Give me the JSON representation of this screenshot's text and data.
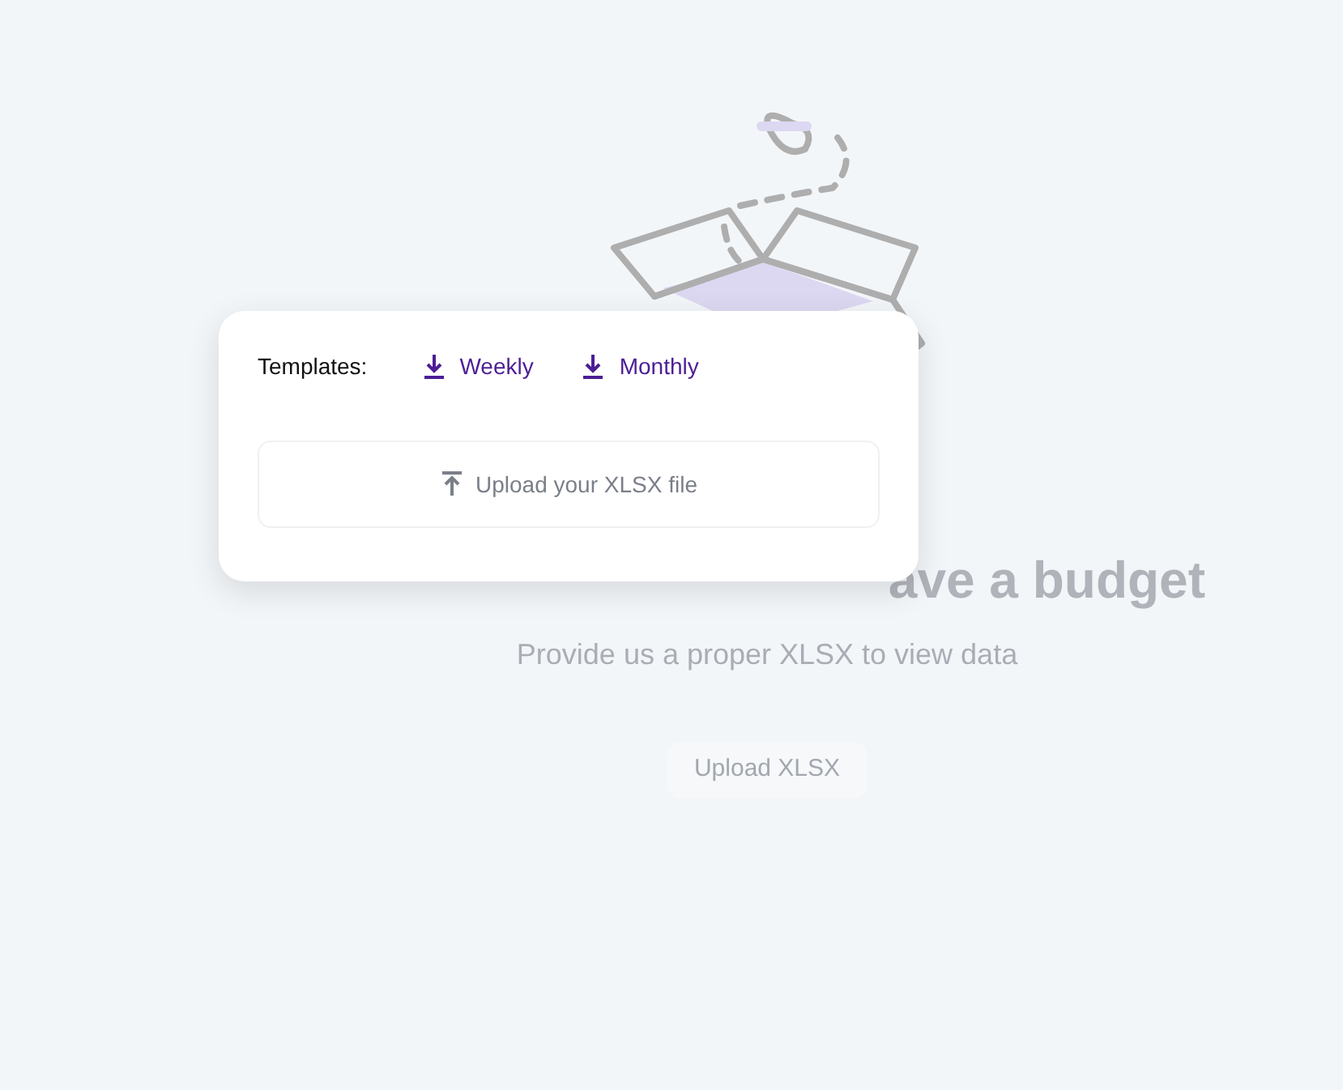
{
  "empty_state": {
    "heading": "ave a budget",
    "subtitle": "Provide us a proper XLSX to view data",
    "button": "Upload XLSX"
  },
  "popup": {
    "templates_label": "Templates:",
    "templates": [
      {
        "label": "Weekly"
      },
      {
        "label": "Monthly"
      }
    ],
    "dropzone": {
      "label": "Upload your XLSX file"
    }
  }
}
